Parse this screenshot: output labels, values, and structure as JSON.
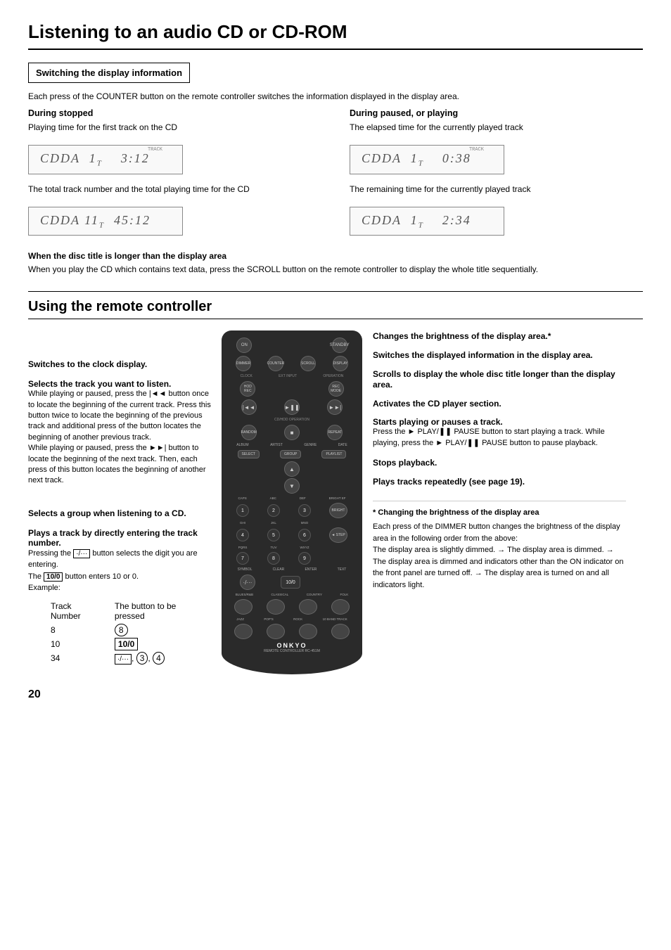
{
  "page": {
    "title": "Listening to an audio CD or CD-ROM",
    "number": "20"
  },
  "switching_display": {
    "box_title": "Switching the display information",
    "body": "Each press of the COUNTER button on the remote controller switches the information displayed in the display area.",
    "during_stopped": {
      "heading": "During stopped",
      "desc": "Playing time for the first track on the CD",
      "display1": "CDDA  1T    3:12",
      "display1_label": "TRACK",
      "desc2": "The total track number and the total playing time for the CD",
      "display2": "CDDA  11T  45:12"
    },
    "during_paused": {
      "heading": "During paused, or playing",
      "desc": "The elapsed time for the currently played track",
      "display1": "CDDA  1T    0:38",
      "display1_label": "TRACK",
      "desc2": "The remaining time for the currently played track",
      "display2": "CDDA  1T    2:34"
    },
    "disc_title_note": {
      "heading": "When the disc title is longer than the display area",
      "body": "When you play the CD which contains text data, press the SCROLL button on the remote controller to display the whole title sequentially."
    }
  },
  "remote_section": {
    "title": "Using the remote controller",
    "left_annotations": [
      {
        "id": "clock-display",
        "bold": "Switches to the clock display."
      },
      {
        "id": "select-track",
        "bold": "Selects the track you want to listen.",
        "text": "While playing or paused, press the |◄◄ button once to locate the beginning of the current track. Press this button twice to locate the beginning of the previous track and additional press of the button locates the beginning of another previous track.\nWhile playing or paused, press the ►►| button to locate the beginning of the next track. Then, each press of this button locates the beginning of another next track."
      },
      {
        "id": "select-group",
        "bold": "Selects a group when listening to a CD."
      },
      {
        "id": "direct-track",
        "bold": "Plays a track by directly entering the track number.",
        "text": "Pressing the (·/···) button selects the digit you are entering.\nThe 10/0 button enters 10 or 0.\nExample:"
      }
    ],
    "track_examples": [
      {
        "number": "8",
        "button": "8"
      },
      {
        "number": "10",
        "button": "10/0"
      },
      {
        "number": "34",
        "button": "(·/···), 3, 4"
      }
    ],
    "right_annotations": [
      {
        "id": "brightness",
        "bold": "Changes the brightness of the display area.*"
      },
      {
        "id": "switch-display",
        "bold": "Switches the displayed information in the display area."
      },
      {
        "id": "scroll-display",
        "bold": "Scrolls to display the whole disc title longer than the display area."
      },
      {
        "id": "activate-cd",
        "bold": "Activates the CD player section."
      },
      {
        "id": "play-pause",
        "bold": "Starts playing or pauses a track.",
        "text": "Press the ► PLAY/❚❚ PAUSE button to start playing a track. While playing, press the ► PLAY/❚❚ PAUSE button to pause playback."
      },
      {
        "id": "stop",
        "bold": "Stops playback."
      },
      {
        "id": "repeat",
        "bold": "Plays tracks repeatedly (see page 19)."
      }
    ],
    "footnote": {
      "marker": "*",
      "heading": "Changing the brightness of the display area",
      "text": "Each press of the DIMMER button changes the brightness of the display area in the following order from the above:\nThe display area is slightly dimmed. → The display area is dimmed. → The display area is dimmed and indicators other than the ON indicator on the front panel are turned off. → The display area is turned on and all indicators light."
    }
  }
}
